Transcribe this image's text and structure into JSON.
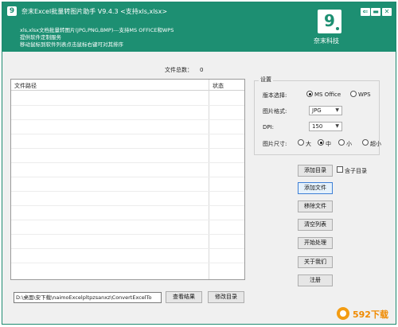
{
  "header": {
    "app_icon_text": "9",
    "title": "奈末Excel批量转图片助手    V9.4.3   <支持xls,xlsx>",
    "desc_lines": [
      "xls,xlsx文档批量转图片(JPG,PNG,BMP)---支持MS OFFICE和WPS",
      "提供软件定制服务",
      "移动鼠标到软件列表点击鼠标右键可对其排序"
    ],
    "brand_logo_text": "9",
    "brand_name": "奈末科技",
    "window_buttons": {
      "back": "⇐",
      "minimize": "▬",
      "close": "✕"
    }
  },
  "file_total": {
    "label": "文件总数：",
    "value": "0"
  },
  "file_list": {
    "columns": [
      "文件路径",
      "状态"
    ],
    "rows": []
  },
  "output_path": "D:\\桌面\\安下载\\naimoExcelpltpzsanxz\\ConvertExcelTo",
  "bottom_buttons": {
    "view_results": "查看结果",
    "change_dir": "修改目录"
  },
  "settings": {
    "title": "设置",
    "version_label": "版本选择:",
    "version_options": [
      "MS Office",
      "WPS"
    ],
    "version_selected": "MS Office",
    "format_label": "图片格式:",
    "format_value": "JPG",
    "dpi_label": "DPI:",
    "dpi_value": "150",
    "size_label": "图片尺寸:",
    "size_options": [
      "大",
      "中",
      "小",
      "超小"
    ],
    "size_selected": "中"
  },
  "actions": {
    "add_dir": "添加目录",
    "include_subdir": "含子目录",
    "add_file": "添加文件",
    "remove_file": "移除文件",
    "clear_list": "清空列表",
    "start": "开始处理",
    "about": "关于我们",
    "register": "注册"
  },
  "watermark": {
    "text": "592下载"
  },
  "colors": {
    "header_bg": "#1d8f72",
    "window_bg": "#f0f0f0",
    "focus_border": "#3d7fd6"
  }
}
